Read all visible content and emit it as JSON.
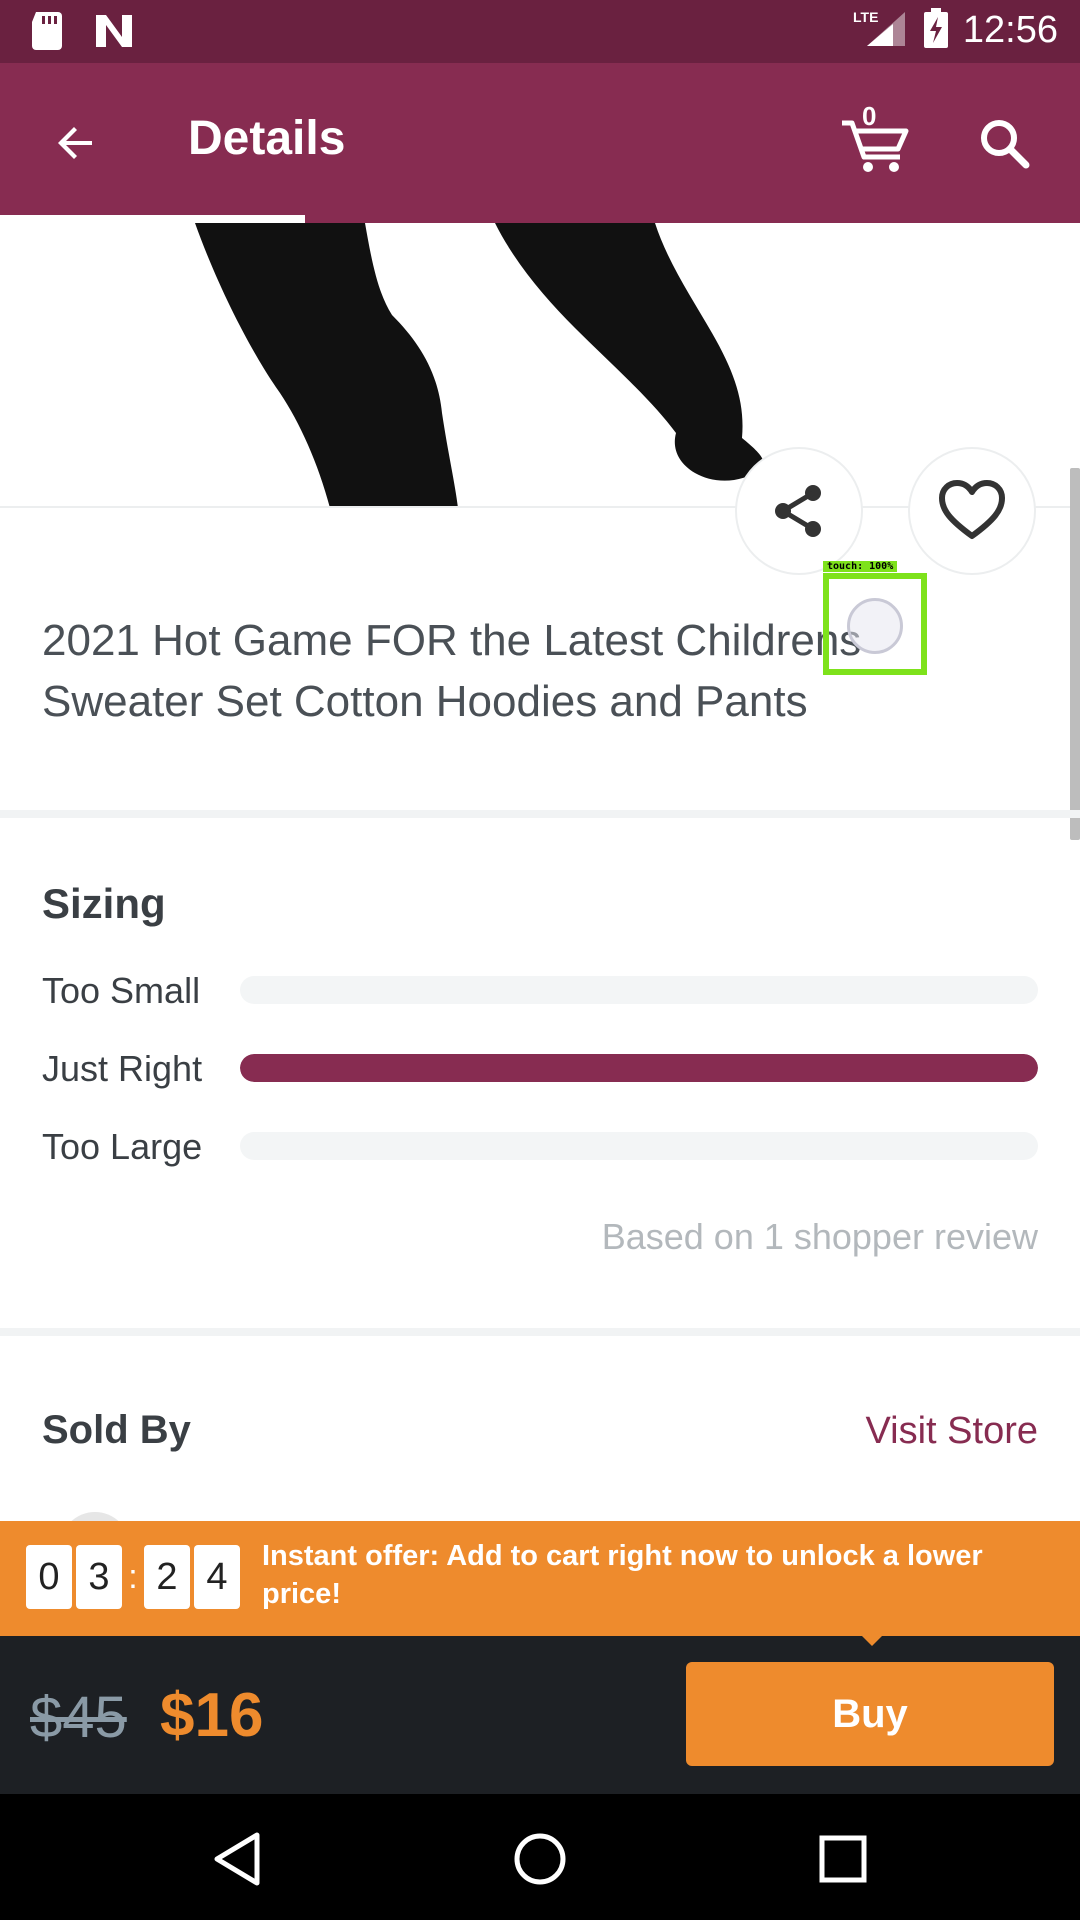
{
  "status_bar": {
    "time": "12:56",
    "network": "LTE"
  },
  "app_bar": {
    "title": "Details",
    "cart_count": "0"
  },
  "product": {
    "title": "2021 Hot Game FOR the Latest Childrens Sweater Set Cotton Hoodies and Pants"
  },
  "touch_overlay": {
    "label": "touch: 100%"
  },
  "sizing": {
    "heading": "Sizing",
    "rows": [
      {
        "label": "Too Small",
        "fraction": 0.0
      },
      {
        "label": "Just Right",
        "fraction": 1.0
      },
      {
        "label": "Too Large",
        "fraction": 0.0
      }
    ],
    "note": "Based on 1 shopper review"
  },
  "sold_by": {
    "heading": "Sold By",
    "visit_store": "Visit Store"
  },
  "offer": {
    "timer_digits": [
      "0",
      "3",
      "2",
      "4"
    ],
    "separator": ":",
    "text": "Instant offer: Add to cart right now to unlock a lower price!"
  },
  "buy_bar": {
    "old_price": "$45",
    "new_price": "$16",
    "buy_label": "Buy"
  },
  "colors": {
    "brand": "#872c51",
    "status_bar": "#6a2140",
    "accent": "#ee8b2d",
    "buy_bar": "#1d2024"
  }
}
